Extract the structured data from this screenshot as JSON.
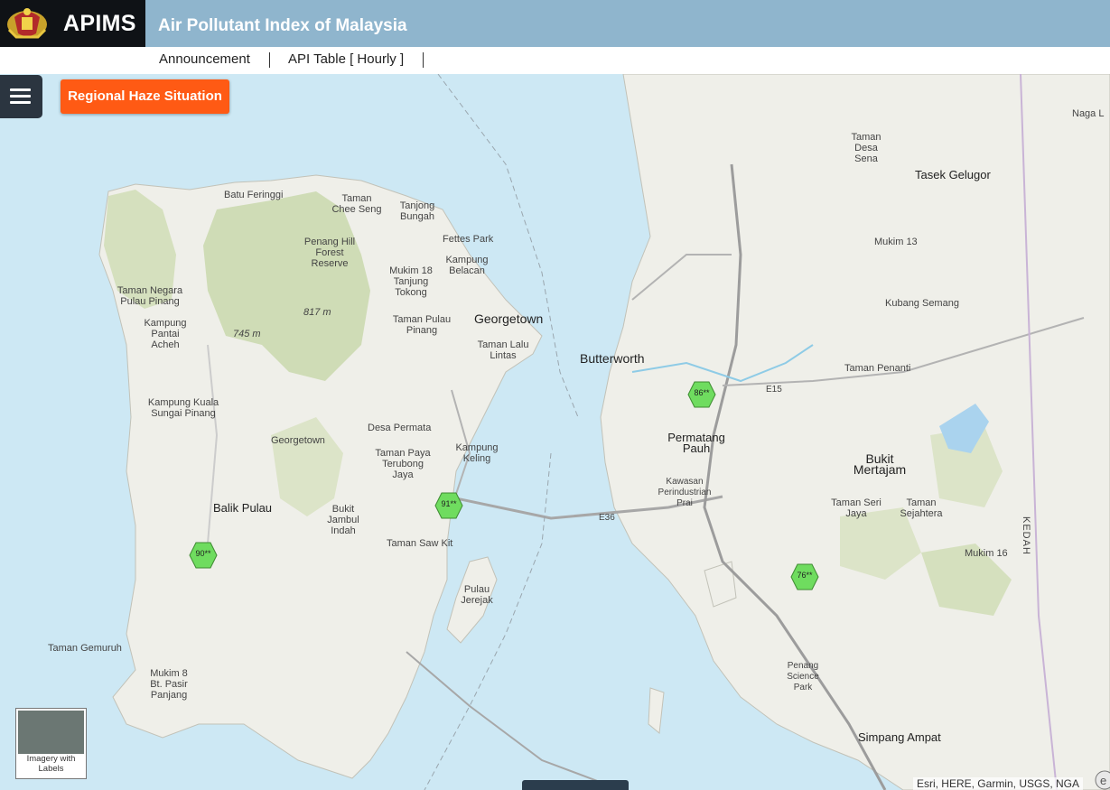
{
  "header": {
    "brand": "APIMS",
    "subtitle": "Air Pollutant Index of Malaysia",
    "crest_icon": "malaysia-coat-of-arms-icon"
  },
  "nav": {
    "items": [
      "Announcement",
      "API Table [ Hourly ]"
    ]
  },
  "toolbar": {
    "menu_icon": "hamburger-menu-icon",
    "haze_button": "Regional Haze Situation"
  },
  "markers": [
    {
      "label": "90**",
      "color": "#6fdc5f"
    },
    {
      "label": "91**",
      "color": "#6fdc5f"
    },
    {
      "label": "86**",
      "color": "#6fdc5f"
    },
    {
      "label": "76**",
      "color": "#6fdc5f"
    }
  ],
  "basemap": {
    "label": "Imagery with Labels"
  },
  "attribution": "Esri, HERE, Garmin, USGS, NGA",
  "colors": {
    "header_bg": "#8fb5cd",
    "brand_bg": "#0f1216",
    "haze_button": "#ff5a14",
    "water": "#cde8f4",
    "land": "#efefe9",
    "forest": "#cfdcb6",
    "marker_good": "#6fdc5f"
  },
  "map_labels": {
    "georgetown": "Georgetown",
    "butterworth": "Butterworth",
    "balik_pulau": "Balik Pulau",
    "batu_feringgi": "Batu Feringgi",
    "tasek_gelugor": "Tasek Gelugor",
    "bukit_mertajam": "Bukit Mertajam",
    "permatang_pauh": "Permatang Pauh",
    "simpang_ampat": "Simpang Ampat",
    "taman_penanti": "Taman Penanti",
    "kubang_semang": "Kubang Semang",
    "mukim13": "Mukim 13",
    "mukim16": "Mukim 16",
    "taman_gemuruh": "Taman Gemuruh",
    "mukim8": "Mukim 8 Bt. Pasir Panjang",
    "kg_kuala": "Kampung Kuala Sungai Pinang",
    "kg_pantai": "Kampung Pantai Acheh",
    "taman_negara": "Taman Negara Pulau Pinang",
    "penang_hill": "Penang Hill Forest Reserve",
    "bukit_jambul": "Bukit Jambul Indah",
    "desa_permata": "Desa Permata",
    "taman_paya": "Taman Paya Terubong Jaya",
    "kampung_keling": "Kampung Keling",
    "taman_saw_kit": "Taman Saw Kit",
    "pulau_jerejak": "Pulau Jerejak",
    "taman_seri_jaya": "Taman Seri Jaya",
    "taman_sejahtera": "Taman Sejahtera",
    "penang_science": "Penang Science Park",
    "kawasan_prai": "Kawasan Perindustrian Prai",
    "tanjong_bungah": "Tanjong Bungah",
    "taman_chee_seng": "Taman Chee Seng",
    "fettes_park": "Fettes Park",
    "kampung_belacan": "Kampung Belacan",
    "mukim18": "Mukim 18 Tanjung Tokong",
    "taman_pulau_pinang": "Taman Pulau Pinang",
    "taman_lalu_lintas": "Taman Lalu Lintas",
    "taman_desa_sena": "Taman Desa Sena",
    "kedah": "KEDAH",
    "e36": "E36",
    "e15": "E15",
    "georgetown_small": "Georgetown",
    "naga_l": "Naga L",
    "elev_817": "817 m",
    "elev_745": "745 m"
  }
}
